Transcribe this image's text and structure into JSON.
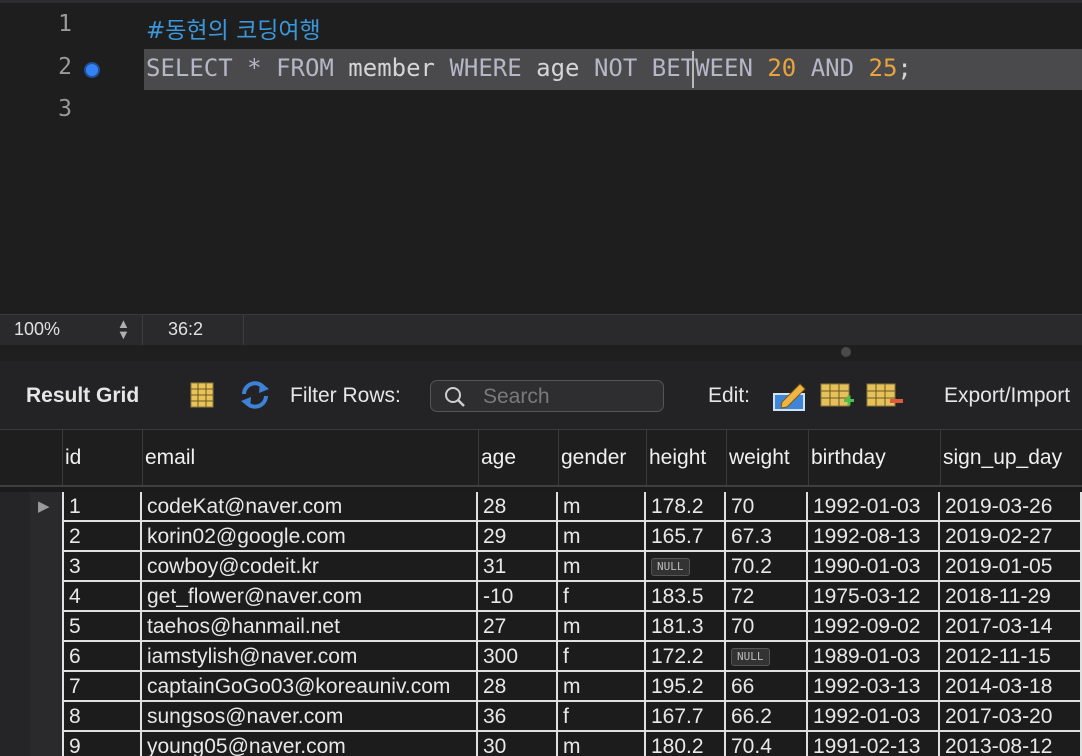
{
  "editor": {
    "line_numbers": [
      "1",
      "2",
      "3"
    ],
    "comment": "#동현의 코딩여행",
    "sql_tokens": [
      {
        "text": "SELECT",
        "kind": "kw"
      },
      {
        "text": " * ",
        "kind": "kw"
      },
      {
        "text": "FROM",
        "kind": "kw"
      },
      {
        "text": " member ",
        "kind": "plain"
      },
      {
        "text": "WHERE",
        "kind": "kw"
      },
      {
        "text": " age ",
        "kind": "plain"
      },
      {
        "text": "NOT BETWEEN",
        "kind": "kw"
      },
      {
        "text": " 20 ",
        "kind": "num"
      },
      {
        "text": "AND",
        "kind": "kw"
      },
      {
        "text": " 25",
        "kind": "num"
      },
      {
        "text": ";",
        "kind": "plain"
      }
    ]
  },
  "status_bar": {
    "zoom": "100%",
    "caret": "36:2"
  },
  "toolbar": {
    "title": "Result Grid",
    "filter_label": "Filter Rows:",
    "search_placeholder": "Search",
    "edit_label": "Edit:",
    "export_label": "Export/Import"
  },
  "grid": {
    "columns": [
      "id",
      "email",
      "age",
      "gender",
      "height",
      "weight",
      "birthday",
      "sign_up_day"
    ],
    "rows": [
      [
        "1",
        "codeKat@naver.com",
        "28",
        "m",
        "178.2",
        "70",
        "1992-01-03",
        "2019-03-26"
      ],
      [
        "2",
        "korin02@google.com",
        "29",
        "m",
        "165.7",
        "67.3",
        "1992-08-13",
        "2019-02-27"
      ],
      [
        "3",
        "cowboy@codeit.kr",
        "31",
        "m",
        "NULL",
        "70.2",
        "1990-01-03",
        "2019-01-05"
      ],
      [
        "4",
        "get_flower@naver.com",
        "-10",
        "f",
        "183.5",
        "72",
        "1975-03-12",
        "2018-11-29"
      ],
      [
        "5",
        "taehos@hanmail.net",
        "27",
        "m",
        "181.3",
        "70",
        "1992-09-02",
        "2017-03-14"
      ],
      [
        "6",
        "iamstylish@naver.com",
        "300",
        "f",
        "172.2",
        "NULL",
        "1989-01-03",
        "2012-11-15"
      ],
      [
        "7",
        "captainGoGo03@koreauniv.com",
        "28",
        "m",
        "195.2",
        "66",
        "1992-03-13",
        "2014-03-18"
      ],
      [
        "8",
        "sungsos@naver.com",
        "36",
        "f",
        "167.7",
        "66.2",
        "1992-01-03",
        "2017-03-20"
      ],
      [
        "9",
        "young05@naver.com",
        "30",
        "m",
        "180.2",
        "70.4",
        "1991-02-13",
        "2013-08-12"
      ]
    ]
  }
}
